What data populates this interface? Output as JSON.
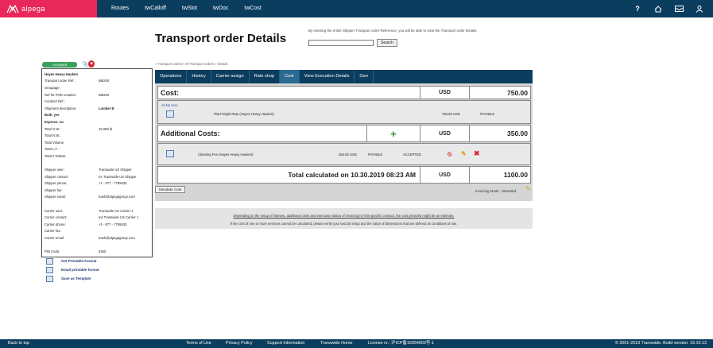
{
  "app": {
    "logo_text": "alpega",
    "brand_color": "#e8275a",
    "nav_color": "#0b3d5e",
    "nav": [
      "Routes",
      "twCalloff",
      "twSlot",
      "twDoc",
      "twCost"
    ],
    "icons": [
      "help-icon",
      "home-icon",
      "inbox-icon",
      "user-icon"
    ]
  },
  "header": {
    "title": "Transport order Details",
    "search_hint": "By entering the entire Shipper Transport order Reference, you will be able to view the Transport order Details:",
    "search_value": "",
    "search_button": "Search"
  },
  "breadcrumb": "» Transport orders» All Transport orders » Details",
  "status": {
    "label": "Accepted",
    "color": "#3aa05a"
  },
  "details": [
    {
      "k": "Hayes Heavy Haulers",
      "v": "",
      "bold": true
    },
    {
      "k": "Transport order Ref.:",
      "v": "MB200"
    },
    {
      "k": "Groupage:",
      "v": ""
    },
    {
      "k": "Ref for POD creation:",
      "v": "MB200"
    },
    {
      "k": "Contract Ref.:",
      "v": ""
    },
    {
      "k": "Shipment description:",
      "v": "Lumber B",
      "vbold": true
    },
    {
      "k": "Bulk: yes",
      "v": "",
      "bold": true
    },
    {
      "k": "Express: no",
      "v": "",
      "bold": true
    },
    {
      "k": "Total G.W.:",
      "v": "15.000 lb"
    },
    {
      "k": "Total N.W.:",
      "v": ""
    },
    {
      "k": "Total Volume:",
      "v": ""
    },
    {
      "k": "Total L.F. :",
      "v": ""
    },
    {
      "k": "Total # Pallets:",
      "v": ""
    },
    {
      "k": "",
      "v": ""
    },
    {
      "k": "Shipper user:",
      "v": "Transwide US   Shipper"
    },
    {
      "k": "Shipper contact:",
      "v": "mr Transwide US Shipper"
    },
    {
      "k": "Shipper phone:",
      "v": "+1 - 877 - 7789433"
    },
    {
      "k": "Shipper fax:",
      "v": ""
    },
    {
      "k": "Shipper email:",
      "v": "trash@alpegagroup.com"
    },
    {
      "k": "",
      "v": ""
    },
    {
      "k": "Carrier user:",
      "v": "Transwide US Carrier 1"
    },
    {
      "k": "Carrier contact:",
      "v": "ms Transwide US Carrier 1"
    },
    {
      "k": "Carrier phone:",
      "v": "+1 - 877 - 7789433"
    },
    {
      "k": "Carrier fax:",
      "v": ""
    },
    {
      "k": "Carrier email:",
      "v": "trash@alpegagroup.com"
    },
    {
      "k": "",
      "v": ""
    },
    {
      "k": "PIN Code:",
      "v": "9250"
    }
  ],
  "side_links": [
    "Get Printable Format",
    "Email printable format",
    "Save as Template"
  ],
  "tabs": [
    "Operations",
    "History",
    "Carrier assign",
    "Rate shop",
    "Cost",
    "View Execution Details",
    "Geo"
  ],
  "active_tab": "Cost",
  "cost": {
    "label": "Cost:",
    "currency": "USD",
    "amount": "750.00",
    "all_no_zero": "All No zero",
    "line": {
      "desc": "Flat Freight Rate (Hayes Heavy Haulers)",
      "amount": "750.00 USD",
      "status": "PAYABLE"
    }
  },
  "additional": {
    "label": "Additional Costs:",
    "currency": "USD",
    "amount": "350.00",
    "line": {
      "desc": "Cleaning Fee (Hayes Heavy Haulers)",
      "amount": "350.00 USD",
      "status": "PAYABLE",
      "state": "ACCEPTED"
    }
  },
  "total": {
    "label": "Total calculated on  10.30.2019 08:23 AM",
    "currency": "USD",
    "amount": "1100.00"
  },
  "simulate_button": "Simulate Cost",
  "invoicing_mode": "Invoicing Mode : Standard",
  "note1": "Depending on the setup of indexes, additional costs and execution status of invoicing for this specific contract, the cost provided might be an estimate.",
  "note2": "If the cost of one or more services cannot be calculated, please verify your twCost setup and the value of dimensions that are defined as conditions of use.",
  "footer": {
    "back": "Back to top",
    "links": [
      "Terms of Use",
      "Privacy Policy",
      "Support Information",
      "Transwide Home",
      "License nr.: 沪ICP备16054003号-1"
    ],
    "copyright": "© 2001-2019 Transwide. Build version: 19.10.13"
  }
}
